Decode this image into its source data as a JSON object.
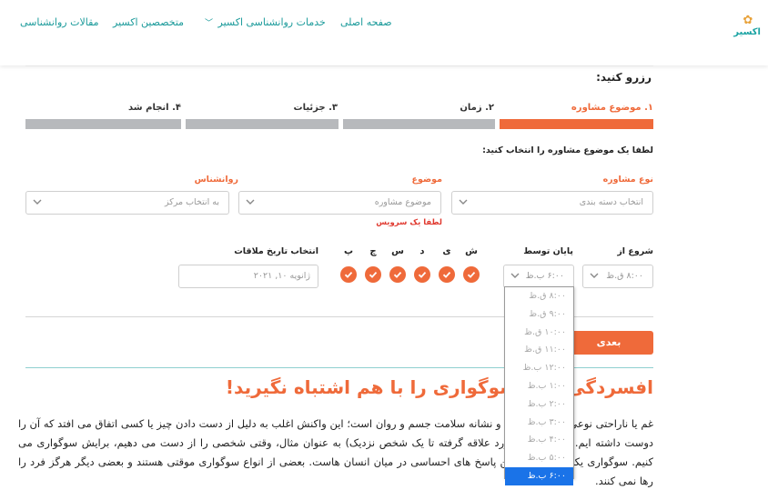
{
  "header": {
    "logo_text": "اکسیر",
    "nav": {
      "home": "صفحه اصلی",
      "services": "خدمات روانشناسی اکسیر",
      "experts": "متخصصین اکسیر",
      "articles": "مقالات روانشناسی"
    }
  },
  "form": {
    "title": "رزرو کنید:",
    "steps": [
      {
        "label": "۱. موضوع مشاوره",
        "active": true
      },
      {
        "label": "۲. زمان",
        "active": false
      },
      {
        "label": "۳. جزئیات",
        "active": false
      },
      {
        "label": "۴. انجام شد",
        "active": false
      }
    ],
    "instruction": "لطفا یک موضوع مشاوره را انتخاب کنید:",
    "fields": {
      "type_label": "نوع مشاوره",
      "type_placeholder": "انتخاب دسته بندی",
      "topic_label": "موضوع",
      "topic_placeholder": "موضوع مشاوره",
      "topic_error": "لطفا یک سرویس",
      "psychologist_label": "روانشناس",
      "psychologist_placeholder": "به انتخاب مرکز"
    },
    "time": {
      "start_label": "شروع از",
      "start_value": "۸:۰۰ ق.ظ",
      "end_label": "پایان توسط",
      "end_value": "۶:۰۰ ب.ظ"
    },
    "days": [
      "ش",
      "ی",
      "د",
      "س",
      "چ",
      "پ"
    ],
    "date": {
      "label": "انتخاب تاریخ ملاقات",
      "placeholder": "ژانویه ۱۰, ۲۰۲۱"
    },
    "next_button": "بعدی"
  },
  "dropdown": {
    "options": [
      "۸:۰۰ ق.ظ",
      "۹:۰۰ ق.ظ",
      "۱۰:۰۰ ق.ظ",
      "۱۱:۰۰ ق.ظ",
      "۱۲:۰۰ ب.ظ",
      "۱:۰۰ ب.ظ",
      "۲:۰۰ ب.ظ",
      "۳:۰۰ ب.ظ",
      "۴:۰۰ ب.ظ",
      "۵:۰۰ ب.ظ",
      "۶:۰۰ ب.ظ"
    ],
    "selected": "۶:۰۰ ب.ظ"
  },
  "article": {
    "title": "افسردگی را با سوگواری را با هم اشتباه نگیرید!",
    "body": "غم یا ناراحتی نوعی واکنش طبیعی و نشانه سلامت جسم و روان است؛ این واکنش اغلب به دلیل از دست دادن چیز یا کسی اتفاق می افتد که آن را دوست داشته ایم. (از عروسک مورد علاقه گرفته تا یک شخص نزدیک) به عنوان مثال، وقتی شخصی را از دست می دهیم، برایش سوگواری می کنیم. سوگواری یکی از پیچیده ترین پاسخ های احساسی در میان انسان هاست. بعضی از انواع سوگواری موقتی هستند و بعضی دیگر هرگز فرد را رها نمی کنند."
  },
  "colors": {
    "accent": "#ef6a3a",
    "teal": "#1a9a9a",
    "inactive_step": "#b7b9bc",
    "error": "#e0392f",
    "selection": "#1a73e8"
  }
}
